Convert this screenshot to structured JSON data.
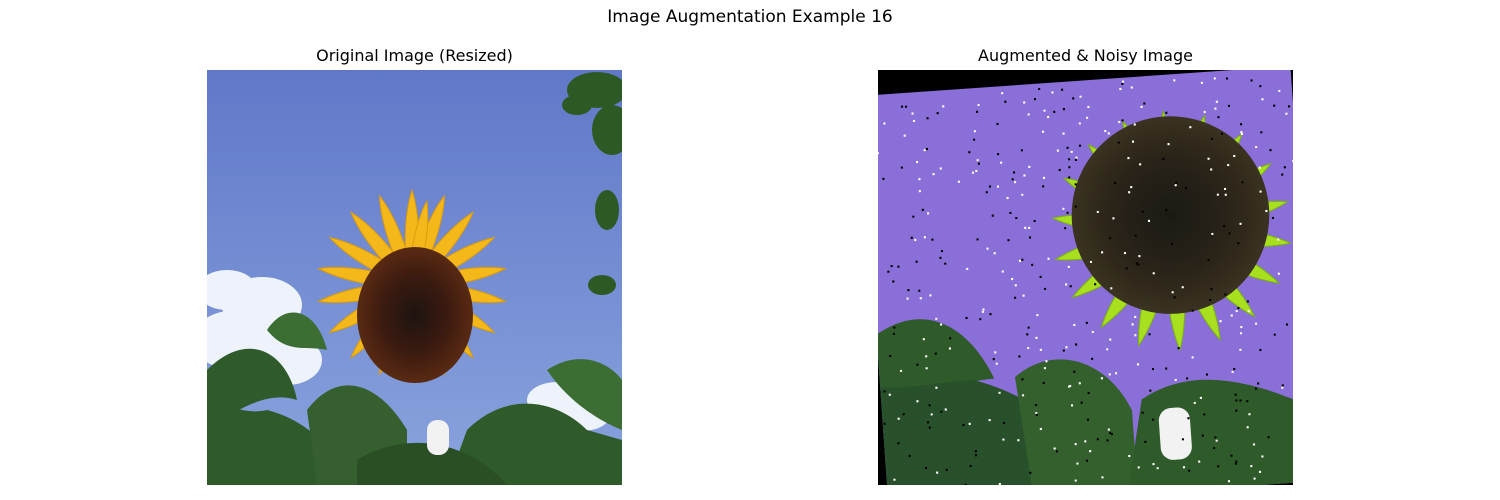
{
  "figure": {
    "title": "Image Augmentation Example 16"
  },
  "panels": [
    {
      "title": "Original Image (Resized)"
    },
    {
      "title": "Augmented & Noisy Image"
    }
  ],
  "colors": {
    "sky_original": "#6b86cf",
    "petal_original": "#f4b81a",
    "disc_original": "#3a1a10",
    "sky_augmented": "#8a6fd8",
    "petal_augmented": "#a8e020",
    "disc_augmented": "#2a2318",
    "foliage": "#2f5a2a"
  }
}
